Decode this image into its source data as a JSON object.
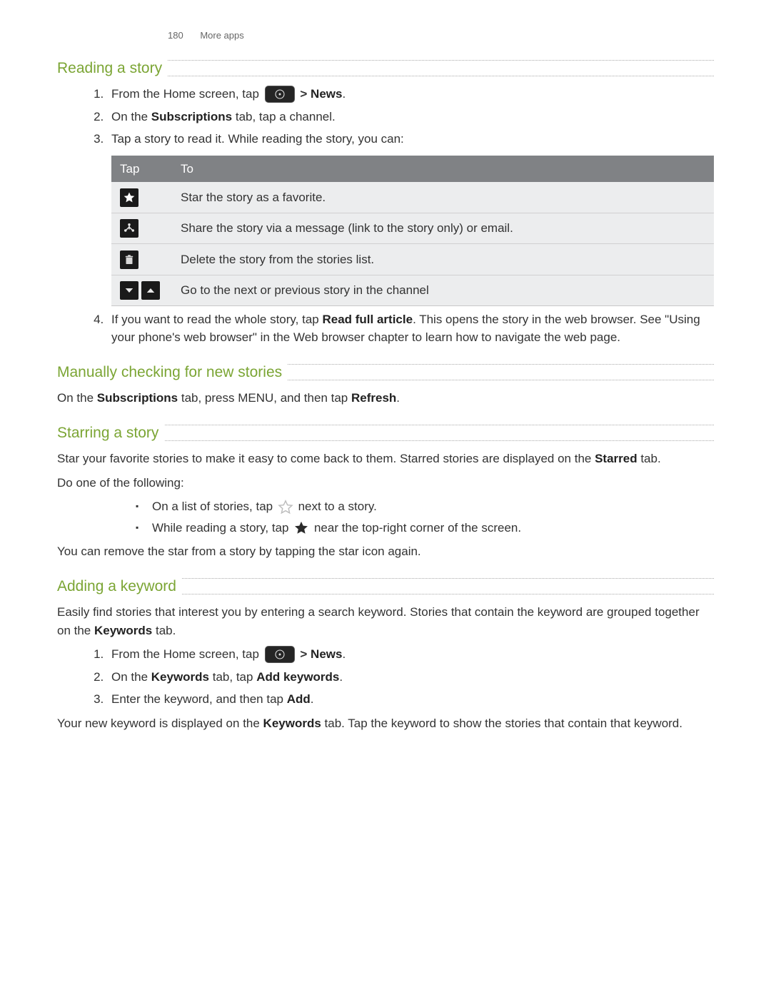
{
  "header": {
    "page_number": "180",
    "chapter": "More apps"
  },
  "sections": {
    "reading": {
      "title": "Reading a story",
      "step1_pre": "From the Home screen, tap ",
      "step1_post_chev": ">",
      "step1_news": "News",
      "step1_period": ".",
      "step2_pre": "On the ",
      "step2_bold": "Subscriptions",
      "step2_post": " tab, tap a channel.",
      "step3": "Tap a story to read it. While reading the story, you can:",
      "table": {
        "col_tap": "Tap",
        "col_to": "To",
        "rows": [
          "Star the story as a favorite.",
          "Share the story via a message (link to the story only) or email.",
          "Delete the story from the stories list.",
          "Go to the next or previous story in the channel"
        ]
      },
      "step4_pre": "If you want to read the whole story, tap ",
      "step4_bold": "Read full article",
      "step4_post": ". This opens the story in the web browser. See \"Using your phone's web browser\" in the Web browser chapter to learn how to navigate the web page."
    },
    "manual": {
      "title": "Manually checking for new stories",
      "p_pre": "On the ",
      "p_b1": "Subscriptions",
      "p_mid": " tab, press MENU, and then tap ",
      "p_b2": "Refresh",
      "p_end": "."
    },
    "starring": {
      "title": "Starring a story",
      "p1_pre": "Star your favorite stories to make it easy to come back to them. Starred stories are displayed on the ",
      "p1_bold": "Starred",
      "p1_post": " tab.",
      "p2": "Do one of the following:",
      "b1_pre": "On a list of stories, tap ",
      "b1_post": " next to a story.",
      "b2_pre": "While reading a story, tap ",
      "b2_post": " near the top-right corner of the screen.",
      "p3": "You can remove the star from a story by tapping the star icon again."
    },
    "keyword": {
      "title": "Adding a keyword",
      "p1_pre": "Easily find stories that interest you by entering a search keyword. Stories that contain the keyword are grouped together on the ",
      "p1_bold": "Keywords",
      "p1_post": " tab.",
      "step1_pre": "From the Home screen, tap ",
      "step1_chev": ">",
      "step1_news": "News",
      "step1_period": ".",
      "step2_pre": "On the ",
      "step2_b1": "Keywords",
      "step2_mid": " tab, tap ",
      "step2_b2": "Add keywords",
      "step2_end": ".",
      "step3_pre": "Enter the keyword, and then tap ",
      "step3_bold": "Add",
      "step3_end": ".",
      "p2_pre": "Your new keyword is displayed on the ",
      "p2_bold": "Keywords",
      "p2_post": " tab. Tap the keyword to show the stories that contain that keyword."
    }
  }
}
